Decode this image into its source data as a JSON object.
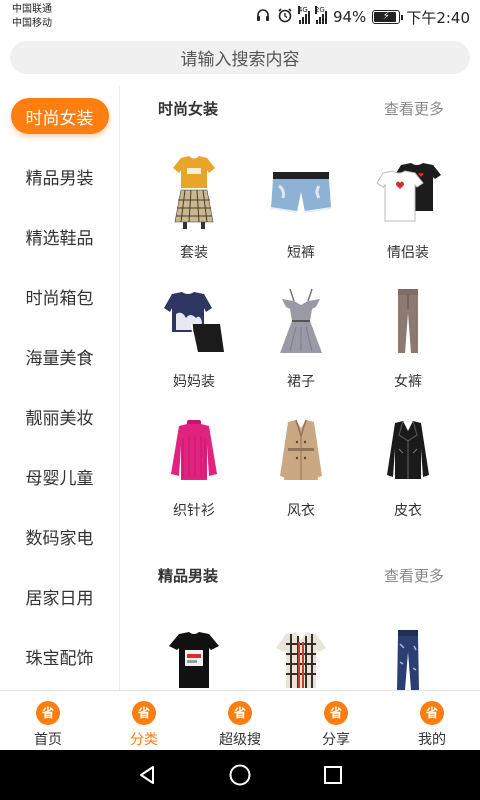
{
  "status_bar": {
    "carrier1": "中国联通",
    "carrier2": "中国移动",
    "net1": "4G",
    "net2": "2G",
    "battery": "94%",
    "battery_level": 0.94,
    "time": "下午2:40"
  },
  "search": {
    "placeholder": "请输入搜索内容"
  },
  "sidebar": {
    "items": [
      {
        "label": "时尚女装",
        "active": true
      },
      {
        "label": "精品男装"
      },
      {
        "label": "精选鞋品"
      },
      {
        "label": "时尚箱包"
      },
      {
        "label": "海量美食"
      },
      {
        "label": "靓丽美妆"
      },
      {
        "label": "母婴儿童"
      },
      {
        "label": "数码家电"
      },
      {
        "label": "居家日用"
      },
      {
        "label": "珠宝配饰"
      }
    ]
  },
  "sections": [
    {
      "title": "时尚女装",
      "more": "查看更多",
      "items": [
        {
          "label": "套装",
          "icon": "outfit-set-image"
        },
        {
          "label": "短裤",
          "icon": "denim-shorts-image"
        },
        {
          "label": "情侣装",
          "icon": "couple-tshirts-image"
        },
        {
          "label": "妈妈装",
          "icon": "mom-outfit-image"
        },
        {
          "label": "裙子",
          "icon": "dress-image"
        },
        {
          "label": "女裤",
          "icon": "women-pants-image"
        },
        {
          "label": "织针衫",
          "icon": "knit-sweater-image"
        },
        {
          "label": "风衣",
          "icon": "trench-coat-image"
        },
        {
          "label": "皮衣",
          "icon": "leather-jacket-image"
        }
      ]
    },
    {
      "title": "精品男装",
      "more": "查看更多",
      "items": [
        {
          "icon": "men-tshirt-image"
        },
        {
          "icon": "plaid-shirt-image"
        },
        {
          "icon": "men-jeans-image"
        }
      ]
    }
  ],
  "tabbar": {
    "icon_glyph": "省",
    "tabs": [
      {
        "label": "首页"
      },
      {
        "label": "分类",
        "active": true
      },
      {
        "label": "超级搜"
      },
      {
        "label": "分享"
      },
      {
        "label": "我的"
      }
    ]
  },
  "colors": {
    "accent": "#ff7e12",
    "nav_bg": "#000000",
    "search_bg": "#f0f0f0"
  }
}
